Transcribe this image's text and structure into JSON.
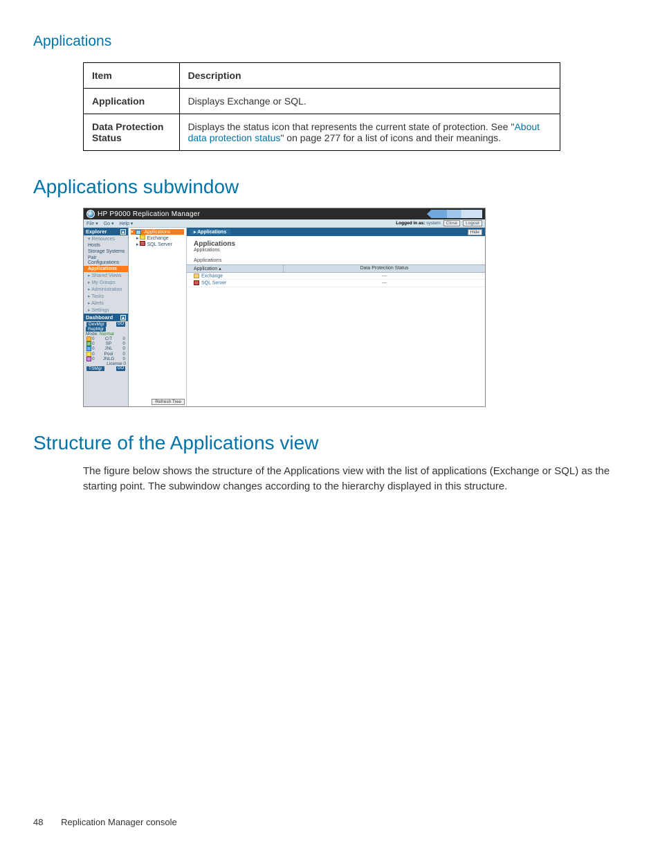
{
  "section1": {
    "title": "Applications",
    "table": {
      "headers": [
        "Item",
        "Description"
      ],
      "rows": [
        {
          "item": "Application",
          "desc": "Displays Exchange or SQL."
        },
        {
          "item": "Data Protection Status",
          "desc_pre": "Displays the status icon that represents the current state of protection. See \"",
          "desc_link": "About data protection status",
          "desc_post": "\" on page 277 for a list of icons and their meanings."
        }
      ]
    }
  },
  "section2": {
    "title": "Applications subwindow"
  },
  "screenshot": {
    "titlebar": "HP P9000 Replication Manager",
    "menus": [
      "File ▾",
      "Go ▾",
      "Help ▾"
    ],
    "loggedin_label": "Logged in as:",
    "loggedin_user": "system",
    "btn_close": "Close",
    "btn_logout": "Logout",
    "explorer": {
      "title": "Explorer",
      "groups": [
        {
          "name": "Resources",
          "items": [
            "Hosts",
            "Storage Systems",
            "Pair Configurations",
            "Applications"
          ],
          "selected": "Applications",
          "expanded": true
        },
        {
          "name": "Shared Views",
          "items": [
            "My Groups"
          ]
        },
        {
          "name": "Administration",
          "items": [
            "Tasks",
            "Alerts",
            "Settings"
          ]
        }
      ]
    },
    "dashboard": {
      "title": "Dashboard",
      "devmgr": "DevMgr",
      "repmgr": "RepMgr",
      "mode_label": "Mode:",
      "mode_value": "Normal",
      "rows": [
        {
          "ic": "or",
          "a": "0",
          "b": "C/T",
          "c": "0"
        },
        {
          "ic": "gr",
          "a": "0",
          "b": "SP",
          "c": "0"
        },
        {
          "ic": "bl",
          "a": "0",
          "b": "JNL",
          "c": "0"
        },
        {
          "ic": "yl",
          "a": "0",
          "b": "Pool",
          "c": "0"
        },
        {
          "ic": "ma",
          "a": "0",
          "b": "JNLG",
          "c": "0"
        }
      ],
      "license": "License 0",
      "tsmgr": "TSMgr",
      "go": "GO"
    },
    "tree": {
      "root": "Applications",
      "items": [
        "Exchange",
        "SQL Server"
      ],
      "refresh": "Refresh Tree"
    },
    "tabbar": {
      "tab": "Applications",
      "hide": "Hide"
    },
    "main": {
      "heading": "Applications",
      "breadcrumb": "Applications",
      "subheading": "Applications",
      "cols": [
        "Application ▴",
        "Data Protection Status"
      ],
      "rows": [
        {
          "name": "Exchange",
          "status": "—"
        },
        {
          "name": "SQL Server",
          "status": "—"
        }
      ]
    }
  },
  "section3": {
    "title": "Structure of the Applications view",
    "paragraph": "The figure below shows the structure of the Applications view with the list of applications (Exchange or SQL) as the starting point. The subwindow changes according to the hierarchy displayed in this structure."
  },
  "footer": {
    "page": "48",
    "doc": "Replication Manager console"
  }
}
